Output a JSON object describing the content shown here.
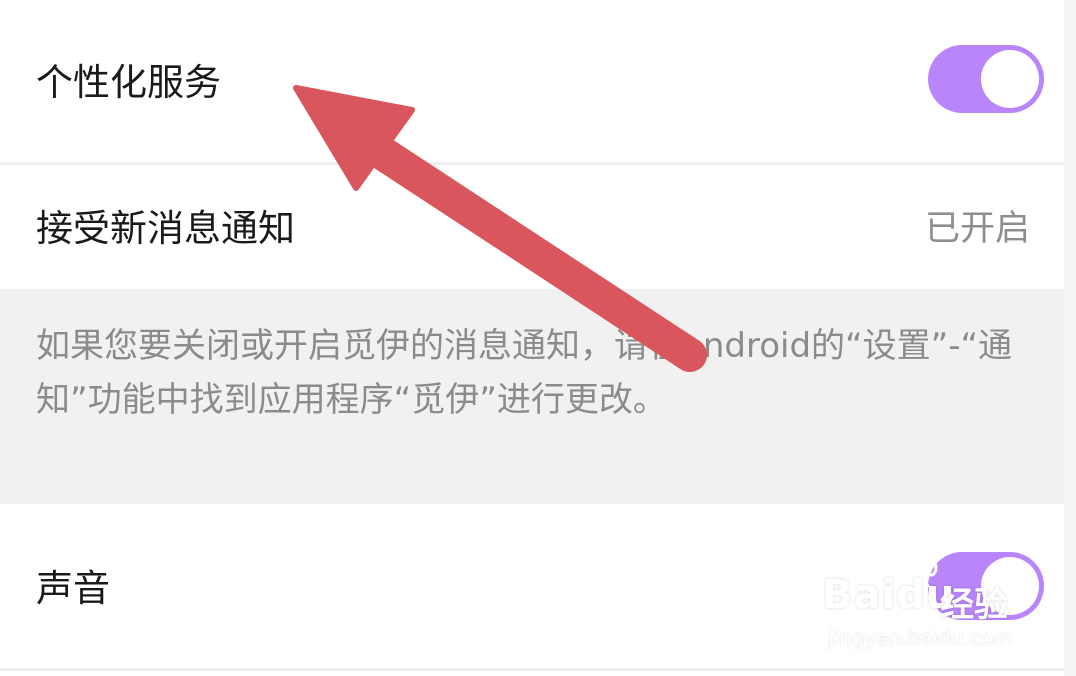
{
  "settings": {
    "personalized": {
      "label": "个性化服务",
      "enabled": true
    },
    "new_message": {
      "label": "接受新消息通知",
      "value": "已开启"
    },
    "notice": "如果您要关闭或开启觅伊的消息通知，请在android的“设置”-“通知”功能中找到应用程序“觅伊”进行更改。",
    "sound": {
      "label": "声音",
      "enabled": true
    }
  },
  "colors": {
    "toggle_on": "#b985fb",
    "arrow": "#d9565c",
    "notice_bg": "#f1f1f1"
  },
  "watermark": {
    "brand": "Baidu",
    "suffix": "经验",
    "url": "jingyan.baidu.com"
  }
}
